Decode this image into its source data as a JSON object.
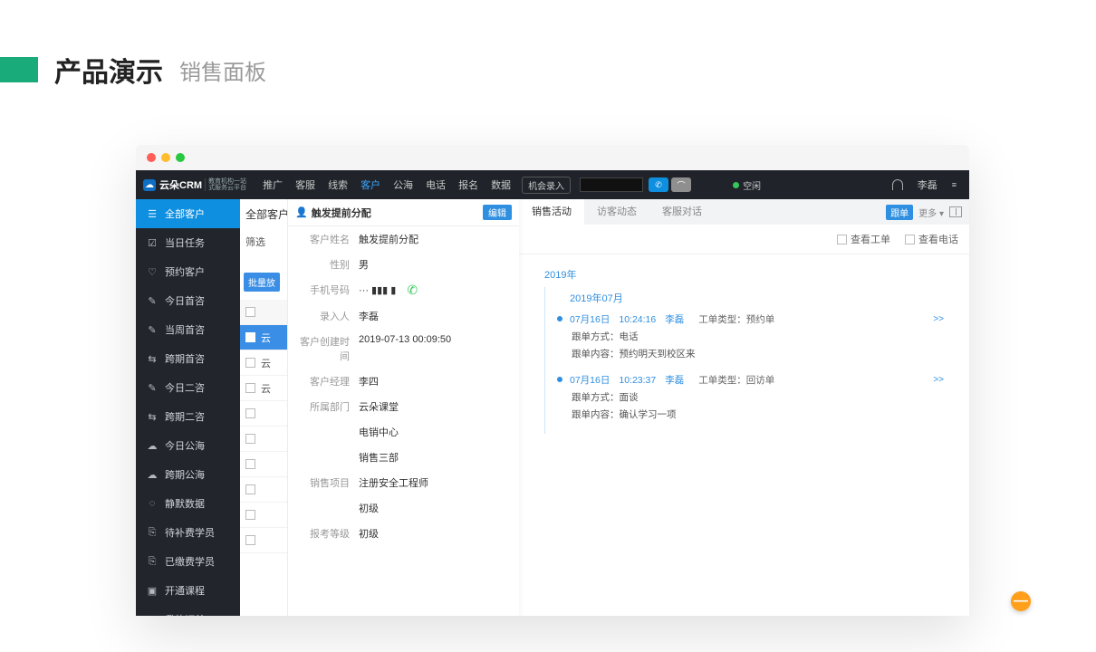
{
  "slide": {
    "title": "产品演示",
    "subtitle": "销售面板"
  },
  "nav": {
    "brand": "云朵CRM",
    "brand_sub1": "教育机构一站",
    "brand_sub2": "式服务云平台",
    "items": [
      "推广",
      "客服",
      "线索",
      "客户",
      "公海",
      "电话",
      "报名",
      "数据"
    ],
    "active": 3,
    "opportunity_btn": "机会录入",
    "status": "空闲",
    "user": "李磊"
  },
  "sidebar": {
    "items": [
      {
        "icon": "☰",
        "label": "全部客户",
        "active": true
      },
      {
        "icon": "☑",
        "label": "当日任务"
      },
      {
        "icon": "♡",
        "label": "预约客户"
      },
      {
        "icon": "✎",
        "label": "今日首咨"
      },
      {
        "icon": "✎",
        "label": "当周首咨"
      },
      {
        "icon": "⇆",
        "label": "跨期首咨"
      },
      {
        "icon": "✎",
        "label": "今日二咨"
      },
      {
        "icon": "⇆",
        "label": "跨期二咨"
      },
      {
        "icon": "☁",
        "label": "今日公海"
      },
      {
        "icon": "☁",
        "label": "跨期公海"
      },
      {
        "icon": "◌",
        "label": "静默数据"
      },
      {
        "icon": "⎘",
        "label": "待补费学员"
      },
      {
        "icon": "⎘",
        "label": "已缴费学员"
      },
      {
        "icon": "▣",
        "label": "开通课程"
      },
      {
        "icon": "≣",
        "label": "我的订单"
      }
    ]
  },
  "mid": {
    "title": "全部客户",
    "filter": "筛选",
    "bulk_btn": "批量放",
    "cells": [
      "云",
      "云",
      "云"
    ]
  },
  "detail": {
    "title": "触发提前分配",
    "edit": "编辑",
    "rows": [
      {
        "label": "客户姓名",
        "value": "触发提前分配"
      },
      {
        "label": "性别",
        "value": "男"
      },
      {
        "label": "手机号码",
        "value": "··· ▮▮▮ ▮",
        "phone": true
      },
      {
        "label": "录入人",
        "value": "李磊"
      },
      {
        "label": "客户创建时间",
        "value": "2019-07-13 00:09:50"
      },
      {
        "label": "客户经理",
        "value": "李四"
      },
      {
        "label": "所属部门",
        "value": "云朵课堂"
      },
      {
        "label": "",
        "value": "电销中心"
      },
      {
        "label": "",
        "value": "销售三部"
      },
      {
        "label": "销售项目",
        "value": "注册安全工程师"
      },
      {
        "label": "",
        "value": "初级"
      },
      {
        "label": "报考等级",
        "value": "初级"
      }
    ]
  },
  "activity": {
    "tabs": [
      "销售活动",
      "访客动态",
      "客服对话"
    ],
    "active": 0,
    "follow_tag": "跟单",
    "more": "更多 ▾",
    "filters": [
      "查看工单",
      "查看电话"
    ],
    "year": "2019年",
    "month": "2019年07月",
    "entries": [
      {
        "date": "07月16日",
        "time": "10:24:16",
        "user": "李磊",
        "type_label": "工单类型：",
        "type": "预约单",
        "lines": [
          {
            "k": "跟单方式：",
            "v": "电话"
          },
          {
            "k": "跟单内容：",
            "v": "预约明天到校区来"
          }
        ]
      },
      {
        "date": "07月16日",
        "time": "10:23:37",
        "user": "李磊",
        "type_label": "工单类型：",
        "type": "回访单",
        "lines": [
          {
            "k": "跟单方式：",
            "v": "面谈"
          },
          {
            "k": "跟单内容：",
            "v": "确认学习一项"
          }
        ]
      }
    ],
    "more_arrows": ">>"
  }
}
